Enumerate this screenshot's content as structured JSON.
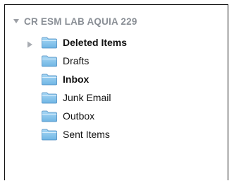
{
  "account": {
    "name": "CR ESM LAB AQUIA 229",
    "expanded": true,
    "disclosure_icon": "triangle-down-icon"
  },
  "folders": [
    {
      "label": "Deleted Items",
      "bold": true,
      "has_children": true,
      "expanded": false,
      "icon": "folder-icon"
    },
    {
      "label": "Drafts",
      "bold": false,
      "has_children": false,
      "icon": "folder-icon"
    },
    {
      "label": "Inbox",
      "bold": true,
      "has_children": false,
      "icon": "folder-icon"
    },
    {
      "label": "Junk Email",
      "bold": false,
      "has_children": false,
      "icon": "folder-icon"
    },
    {
      "label": "Outbox",
      "bold": false,
      "has_children": false,
      "icon": "folder-icon"
    },
    {
      "label": "Sent Items",
      "bold": false,
      "has_children": false,
      "icon": "folder-icon"
    }
  ],
  "colors": {
    "account_label": "#8a8f96",
    "folder_label": "#111111",
    "folder_fill_top": "#a9d8f5",
    "folder_fill_bottom": "#6fb5e4",
    "folder_outline": "#4a8ac0",
    "disclosure": "#9a9ea4"
  }
}
